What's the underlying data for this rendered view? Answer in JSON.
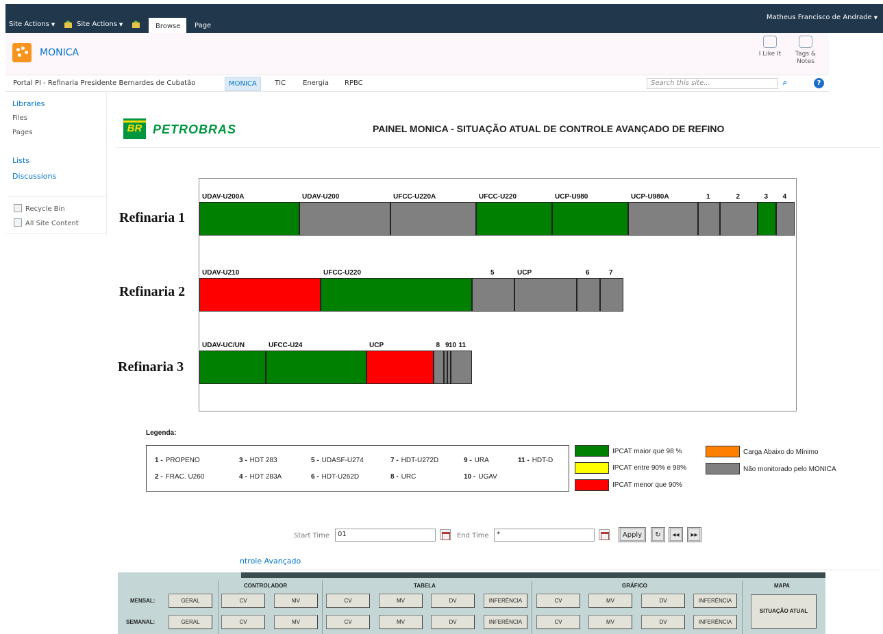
{
  "ribbon": {
    "site_actions_1": "Site Actions",
    "site_actions_2": "Site Actions",
    "tab_browse": "Browse",
    "tab_page": "Page",
    "user": "Matheus Francisco de Andrade"
  },
  "site": {
    "title": "MONICA",
    "i_like_it": "I Like It",
    "tags_notes_1": "Tags &",
    "tags_notes_2": "Notes"
  },
  "topnav": {
    "portal": "Portal PI - Refinaria Presidente Bernardes de Cubatão",
    "monica": "MONICA",
    "tic": "TIC",
    "energia": "Energia",
    "rpbc": "RPBC",
    "search_placeholder": "Search this site..."
  },
  "quicklaunch": {
    "libraries": "Libraries",
    "files": "Files",
    "pages": "Pages",
    "lists": "Lists",
    "discussions": "Discussions",
    "recycle_bin": "Recycle Bin",
    "all_site_content": "All Site Content"
  },
  "content": {
    "logo_br": "BR",
    "logo_word": "PETROBRAS",
    "panel_title": "PAINEL MONICA - SITUAÇÃO ATUAL DE CONTROLE AVANÇADO DE REFINO"
  },
  "refinarias": [
    {
      "name": "Refinaria 1",
      "units": [
        {
          "label": "UDAV-U200A",
          "status": "green",
          "share": 146
        },
        {
          "label": "UDAV-U200",
          "status": "gray",
          "share": 133
        },
        {
          "label": "UFCC-U220A",
          "status": "gray",
          "share": 125
        },
        {
          "label": "UFCC-U220",
          "status": "green",
          "share": 111
        },
        {
          "label": "UCP-U980",
          "status": "green",
          "share": 111
        },
        {
          "label": "UCP-U980A",
          "status": "gray",
          "share": 102
        },
        {
          "label": "1",
          "status": "gray",
          "share": 32
        },
        {
          "label": "2",
          "status": "gray",
          "share": 55
        },
        {
          "label": "3",
          "status": "green",
          "share": 27
        },
        {
          "label": "4",
          "status": "gray",
          "share": 27
        }
      ]
    },
    {
      "name": "Refinaria 2",
      "units": [
        {
          "label": "UDAV-U210",
          "status": "red",
          "share": 177
        },
        {
          "label": "UFCC-U220",
          "status": "green",
          "share": 221
        },
        {
          "label": "5",
          "status": "gray",
          "share": 62
        },
        {
          "label": "UCP",
          "status": "gray",
          "share": 91
        },
        {
          "label": "6",
          "status": "gray",
          "share": 34
        },
        {
          "label": "7",
          "status": "gray",
          "share": 34
        }
      ]
    },
    {
      "name": "Refinaria 3",
      "units": [
        {
          "label": "UDAV-UC/UN",
          "status": "green",
          "share": 97
        },
        {
          "label": "UFCC-U24",
          "status": "green",
          "share": 147
        },
        {
          "label": "UCP",
          "status": "red",
          "share": 98
        },
        {
          "label": "8",
          "status": "gray",
          "share": 15
        },
        {
          "label": "9",
          "status": "gray",
          "share": 5
        },
        {
          "label": "10",
          "status": "gray",
          "share": 5
        },
        {
          "label": "11",
          "status": "gray",
          "share": 31
        }
      ]
    }
  ],
  "legend": {
    "title": "Legenda:",
    "items": [
      {
        "num": "1 -",
        "name": "PROPENO"
      },
      {
        "num": "2 -",
        "name": "FRAC. U260"
      },
      {
        "num": "3 -",
        "name": "HDT 283"
      },
      {
        "num": "4 -",
        "name": "HDT 283A"
      },
      {
        "num": "5 -",
        "name": "UDASF-U274"
      },
      {
        "num": "6 -",
        "name": "HDT-U262D"
      },
      {
        "num": "7 -",
        "name": "HDT-U272D"
      },
      {
        "num": "8 -",
        "name": "URC"
      },
      {
        "num": "9 -",
        "name": "URA"
      },
      {
        "num": "10 -",
        "name": "UGAV"
      },
      {
        "num": "11 -",
        "name": "HDT-D"
      }
    ],
    "colors": [
      {
        "color": "#008000",
        "text": "IPCAT maior que 98 %"
      },
      {
        "color": "#ffff00",
        "text": "IPCAT entre 90% e 98%"
      },
      {
        "color": "#ff0000",
        "text": "IPCAT menor que 90%"
      },
      {
        "color": "#ff8000",
        "text": "Carga Abaixo do Mínimo"
      },
      {
        "color": "#808080",
        "text": "Não monitorado pelo MONICA"
      }
    ]
  },
  "time": {
    "start_label": "Start Time",
    "start_value": "01",
    "end_label": "End Time",
    "end_value": "*",
    "apply": "Apply"
  },
  "controle": {
    "link": "ntrole Avançado"
  },
  "matrix": {
    "headers": [
      "CONTROLADOR",
      "TABELA",
      "GRÁFICO",
      "MAPA"
    ],
    "row_mensal": "MENSAL:",
    "row_semanal": "SEMANAL:",
    "geral": "GERAL",
    "cv": "CV",
    "mv": "MV",
    "dv": "DV",
    "inferencia": "INFERÊNCIA",
    "situacao": "SITUAÇÃO ATUAL"
  }
}
